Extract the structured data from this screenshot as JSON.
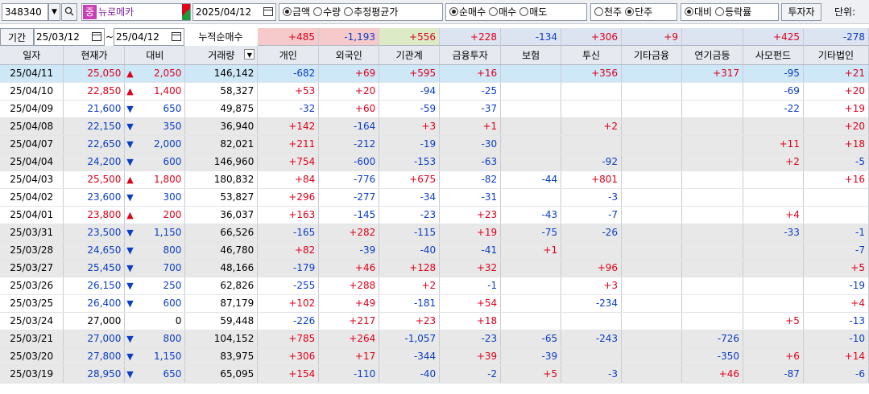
{
  "toolbar": {
    "code": "348340",
    "badge": "중",
    "name": "뉴로메카",
    "date": "2025/04/12",
    "group1": [
      {
        "label": "금액",
        "on": true
      },
      {
        "label": "수량",
        "on": false
      },
      {
        "label": "추정평균가",
        "on": false
      }
    ],
    "group2": [
      {
        "label": "순매수",
        "on": true
      },
      {
        "label": "매수",
        "on": false
      },
      {
        "label": "매도",
        "on": false
      }
    ],
    "group3": [
      {
        "label": "천주",
        "on": false
      },
      {
        "label": "단주",
        "on": true
      }
    ],
    "group4": [
      {
        "label": "대비",
        "on": true
      },
      {
        "label": "등락률",
        "on": false
      }
    ],
    "investor_btn": "투자자",
    "unit_label": "단위:"
  },
  "period": {
    "label": "기간",
    "from": "25/03/12",
    "sep": "~",
    "to": "25/04/12",
    "cumulative_label": "누적순매수"
  },
  "sums": [
    "+485",
    "-1,193",
    "+556",
    "+228",
    "-134",
    "+306",
    "+9",
    "",
    "+425",
    "-278"
  ],
  "headers": [
    "일자",
    "현재가",
    "대비",
    "거래량",
    "개인",
    "외국인",
    "기관계",
    "금융투자",
    "보험",
    "투신",
    "기타금융",
    "연기금등",
    "사모펀드",
    "기타법인"
  ],
  "rows": [
    [
      "25/04/11",
      "25,050",
      "up",
      "2,050",
      "146,142",
      "-682",
      "+69",
      "+595",
      "+16",
      "",
      "+356",
      "",
      "+317",
      "-95",
      "+21"
    ],
    [
      "25/04/10",
      "22,850",
      "up",
      "1,400",
      "58,327",
      "+53",
      "+20",
      "-94",
      "-25",
      "",
      "",
      "",
      "",
      "-69",
      "+20"
    ],
    [
      "25/04/09",
      "21,600",
      "down",
      "650",
      "49,875",
      "-32",
      "+60",
      "-59",
      "-37",
      "",
      "",
      "",
      "",
      "-22",
      "+19"
    ],
    [
      "25/04/08",
      "22,150",
      "down",
      "350",
      "36,940",
      "+142",
      "-164",
      "+3",
      "+1",
      "",
      "+2",
      "",
      "",
      "",
      "+20"
    ],
    [
      "25/04/07",
      "22,650",
      "down",
      "2,000",
      "82,021",
      "+211",
      "-212",
      "-19",
      "-30",
      "",
      "",
      "",
      "",
      "+11",
      "+18"
    ],
    [
      "25/04/04",
      "24,200",
      "down",
      "600",
      "146,960",
      "+754",
      "-600",
      "-153",
      "-63",
      "",
      "-92",
      "",
      "",
      "+2",
      "-5"
    ],
    [
      "25/04/03",
      "25,500",
      "up",
      "1,800",
      "180,832",
      "+84",
      "-776",
      "+675",
      "-82",
      "-44",
      "+801",
      "",
      "",
      "",
      "+16"
    ],
    [
      "25/04/02",
      "23,600",
      "down",
      "300",
      "53,827",
      "+296",
      "-277",
      "-34",
      "-31",
      "",
      "-3",
      "",
      "",
      "",
      ""
    ],
    [
      "25/04/01",
      "23,800",
      "up",
      "200",
      "36,037",
      "+163",
      "-145",
      "-23",
      "+23",
      "-43",
      "-7",
      "",
      "",
      "+4",
      ""
    ],
    [
      "25/03/31",
      "23,500",
      "down",
      "1,150",
      "66,526",
      "-165",
      "+282",
      "-115",
      "+19",
      "-75",
      "-26",
      "",
      "",
      "-33",
      "-1"
    ],
    [
      "25/03/28",
      "24,650",
      "down",
      "800",
      "46,780",
      "+82",
      "-39",
      "-40",
      "-41",
      "+1",
      "",
      "",
      "",
      "",
      "-7"
    ],
    [
      "25/03/27",
      "25,450",
      "down",
      "700",
      "48,166",
      "-179",
      "+46",
      "+128",
      "+32",
      "",
      "+96",
      "",
      "",
      "",
      "+5"
    ],
    [
      "25/03/26",
      "26,150",
      "down",
      "250",
      "62,826",
      "-255",
      "+288",
      "+2",
      "-1",
      "",
      "+3",
      "",
      "",
      "",
      "-19"
    ],
    [
      "25/03/25",
      "26,400",
      "down",
      "600",
      "87,179",
      "+102",
      "+49",
      "-181",
      "+54",
      "",
      "-234",
      "",
      "",
      "",
      "+4"
    ],
    [
      "25/03/24",
      "27,000",
      "flat",
      "0",
      "59,448",
      "-226",
      "+217",
      "+23",
      "+18",
      "",
      "",
      "",
      "",
      "+5",
      "-13"
    ],
    [
      "25/03/21",
      "27,000",
      "down",
      "800",
      "104,152",
      "+785",
      "+264",
      "-1,057",
      "-23",
      "-65",
      "-243",
      "",
      "-726",
      "",
      "-10"
    ],
    [
      "25/03/20",
      "27,800",
      "down",
      "1,150",
      "83,975",
      "+306",
      "+17",
      "-344",
      "+39",
      "-39",
      "",
      "",
      "-350",
      "+6",
      "+14"
    ],
    [
      "25/03/19",
      "28,950",
      "down",
      "650",
      "65,095",
      "+154",
      "-110",
      "-40",
      "-2",
      "+5",
      "-3",
      "",
      "+46",
      "-87",
      "-6"
    ]
  ],
  "colors": {
    "up": "#e0001b",
    "down": "#0a3dc8",
    "selected": "#cfe8f8",
    "gray": "#e8e8e8",
    "sum_red": "#f6caca",
    "sum_green": "#dcebc6",
    "sum_blue": "#dce3f1"
  }
}
